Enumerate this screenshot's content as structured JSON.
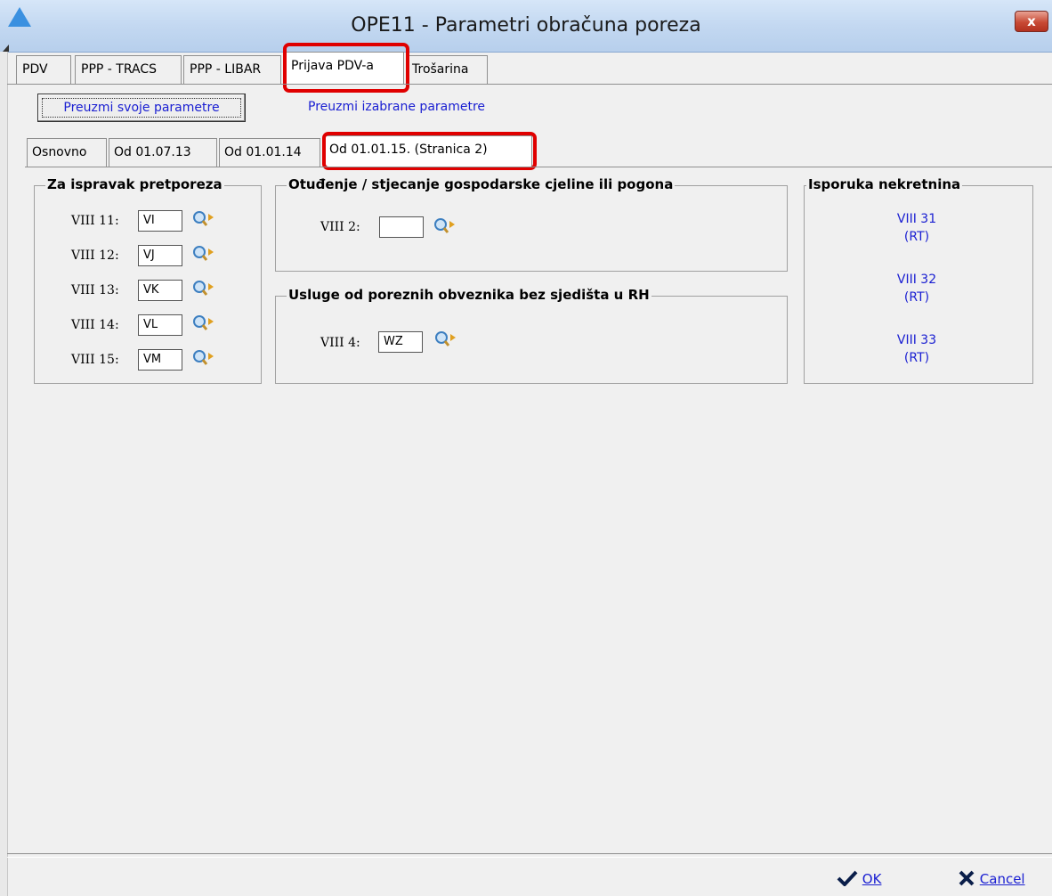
{
  "window": {
    "title": "OPE11 - Parametri obračuna poreza",
    "close_label": "x"
  },
  "tabs": [
    {
      "label": "PDV"
    },
    {
      "label": "PPP - TRACS"
    },
    {
      "label": "PPP - LIBAR"
    },
    {
      "label": "Prijava PDV-a",
      "selected": true
    },
    {
      "label": "Trošarina"
    }
  ],
  "actions": {
    "own_params": "Preuzmi svoje parametre",
    "selected_params": "Preuzmi izabrane parametre"
  },
  "subtabs": [
    {
      "label": "Osnovno"
    },
    {
      "label": "Od 01.07.13"
    },
    {
      "label": "Od 01.01.14"
    },
    {
      "label": "Od 01.01.15. (Stranica 2)",
      "selected": true
    }
  ],
  "groups": {
    "correction": {
      "title": "Za ispravak pretporeza",
      "rows": [
        {
          "label": "VIII 11:",
          "value": "VI"
        },
        {
          "label": "VIII 12:",
          "value": "VJ"
        },
        {
          "label": "VIII 13:",
          "value": "VK"
        },
        {
          "label": "VIII 14:",
          "value": "VL"
        },
        {
          "label": "VIII 15:",
          "value": "VM"
        }
      ]
    },
    "alienation": {
      "title": "Otuđenje / stjecanje gospodarske cjeline ili pogona",
      "label": "VIII 2:",
      "value": ""
    },
    "services": {
      "title": "Usluge od poreznih obveznika bez sjedišta u RH",
      "label": "VIII 4:",
      "value": "WZ"
    },
    "realestate": {
      "title": "Isporuka nekretnina",
      "links": [
        {
          "line1": "VIII 31",
          "line2": "(RT)"
        },
        {
          "line1": "VIII 32",
          "line2": "(RT)"
        },
        {
          "line1": "VIII 33",
          "line2": "(RT)"
        }
      ]
    }
  },
  "footer": {
    "ok": "OK",
    "cancel": "Cancel"
  },
  "colors": {
    "link": "#1b20d2",
    "highlight": "#e00000",
    "titlebar": "#c3d8f1"
  }
}
